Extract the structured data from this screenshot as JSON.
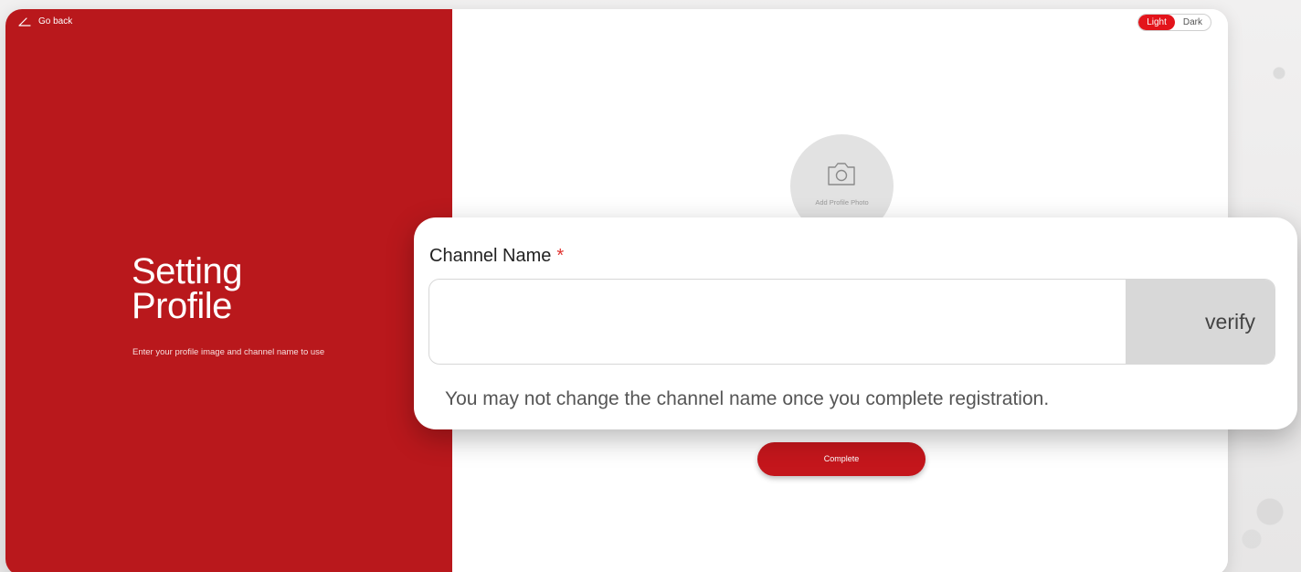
{
  "nav": {
    "back_label": "Go back"
  },
  "hero": {
    "title_line1": "Setting",
    "title_line2": "Profile",
    "subtitle": "Enter your profile image and channel name to use"
  },
  "theme": {
    "light_label": "Light",
    "dark_label": "Dark",
    "selected": "Light"
  },
  "avatar": {
    "label": "Add Profile Photo",
    "icon": "camera-icon"
  },
  "channel": {
    "label": "Channel Name",
    "required_mark": "*",
    "value": "",
    "verify_label": "verify",
    "hint": "You may not change the channel name once you complete registration."
  },
  "actions": {
    "complete_label": "Complete"
  },
  "colors": {
    "brand_red": "#b9181c",
    "button_red": "#c4161c",
    "toggle_active": "#e3141b",
    "required_red": "#e0322f"
  }
}
